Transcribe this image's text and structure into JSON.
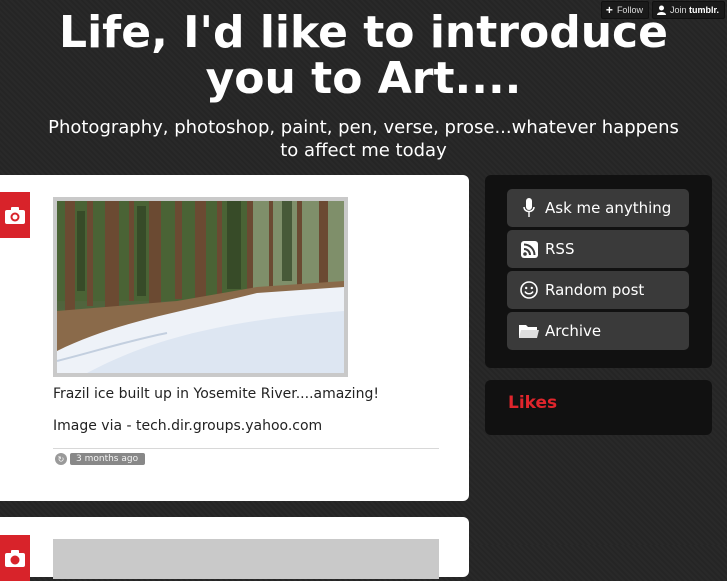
{
  "topbar": {
    "follow_label": "Follow",
    "join_label": "Join",
    "join_brand": "tumblr."
  },
  "site": {
    "title_line1": "Life, I'd like to introduce",
    "title_line2": "you to Art....",
    "description_line1": "Photography, photoshop, paint, pen, verse, prose...whatever happens",
    "description_line2": "to affect me today"
  },
  "posts": [
    {
      "type_icon": "camera-icon",
      "caption": "Frazil ice built up in Yosemite River....amazing!",
      "source": "Image via - tech.dir.groups.yahoo.com",
      "date": "3 months ago"
    }
  ],
  "sidebar": {
    "nav": [
      {
        "label": "Ask me anything",
        "icon": "microphone-icon"
      },
      {
        "label": "RSS",
        "icon": "rss-icon"
      },
      {
        "label": "Random post",
        "icon": "smiley-icon"
      },
      {
        "label": "Archive",
        "icon": "folder-icon"
      }
    ],
    "likes_title": "Likes"
  },
  "colors": {
    "accent": "#d8232a",
    "background": "#262626",
    "panel": "#111111",
    "button": "#3a3a3a"
  }
}
